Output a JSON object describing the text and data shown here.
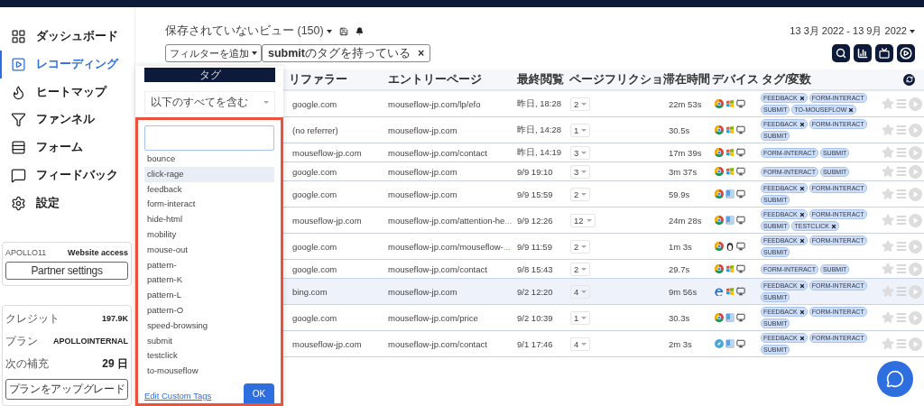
{
  "sidebar": {
    "items": [
      {
        "label": "ダッシュボード",
        "selected": false
      },
      {
        "label": "レコーディング",
        "selected": true
      },
      {
        "label": "ヒートマップ",
        "selected": false
      },
      {
        "label": "ファンネル",
        "selected": false
      },
      {
        "label": "フォーム",
        "selected": false
      },
      {
        "label": "フィードバック",
        "selected": false
      },
      {
        "label": "設定",
        "selected": false
      }
    ],
    "account_card": {
      "name": "APOLLO11",
      "access": "Website access",
      "button": "Partner settings"
    },
    "plan_card": {
      "rows": [
        {
          "label": "クレジット",
          "value": "197.9K"
        },
        {
          "label": "プラン",
          "value": "APOLLOINTERNAL"
        },
        {
          "label": "次の補充",
          "value": "29 日"
        }
      ],
      "button": "プランをアップグレード"
    }
  },
  "toolbar": {
    "view": "保存されていないビュー (150)",
    "date_range": "13 3月 2022 - 13 9月 2022",
    "add_filter": "フィルターを追加",
    "filter_chip": {
      "label": "**submit**のタグを持っている",
      "close": "×"
    }
  },
  "tag_dropdown": {
    "title": "タグ",
    "mode": "以下のすべてを含む",
    "options": [
      {
        "label": "bounce",
        "highlighted": false
      },
      {
        "label": "click-rage",
        "highlighted": true
      },
      {
        "label": "feedback",
        "highlighted": false
      },
      {
        "label": "form-interact",
        "highlighted": false
      },
      {
        "label": "hide-html",
        "highlighted": false
      },
      {
        "label": "mobility",
        "highlighted": false
      },
      {
        "label": "mouse-out",
        "highlighted": false
      },
      {
        "label": "pattern-",
        "highlighted": false
      },
      {
        "label": "pattern-K",
        "highlighted": false
      },
      {
        "label": "pattern-L",
        "highlighted": false
      },
      {
        "label": "pattern-O",
        "highlighted": false
      },
      {
        "label": "speed-browsing",
        "highlighted": false
      },
      {
        "label": "submit",
        "highlighted": false
      },
      {
        "label": "testclick",
        "highlighted": false
      },
      {
        "label": "to-mouseflow",
        "highlighted": false
      }
    ],
    "edit_link": "Edit Custom Tags",
    "ok": "OK"
  },
  "table": {
    "columns": [
      "リファラー",
      "エントリーページ",
      "最終閲覧",
      "ページ",
      "フリクショ",
      "滞在時間",
      "デバイス",
      "タグ/変数"
    ],
    "rows": [
      {
        "referrer": "google.com",
        "entry": "mouseflow-jp.com/lp/efo",
        "last": "昨日, 18:28",
        "pages": "2",
        "duration": "22m 53s",
        "devices": [
          {
            "kind": "chrome"
          },
          {
            "kind": "windows"
          },
          {
            "kind": "desktop"
          }
        ],
        "highlighted": false,
        "tags": [
          {
            "label": "FEEDBACK",
            "removable": true
          },
          {
            "label": "FORM-INTERACT",
            "removable": false
          },
          {
            "label": "SUBMIT",
            "removable": false
          },
          {
            "label": "TO-MOUSEFLOW",
            "removable": true
          }
        ]
      },
      {
        "referrer": "(no referrer)",
        "entry": "mouseflow-jp.com",
        "last": "昨日, 14:28",
        "pages": "1",
        "duration": "30.5s",
        "devices": [
          {
            "kind": "chrome"
          },
          {
            "kind": "windows"
          },
          {
            "kind": "desktop"
          }
        ],
        "highlighted": false,
        "tags": [
          {
            "label": "FEEDBACK",
            "removable": true
          },
          {
            "label": "FORM-INTERACT",
            "removable": false
          },
          {
            "label": "SUBMIT",
            "removable": false
          }
        ]
      },
      {
        "referrer": "mouseflow-jp.com",
        "entry": "mouseflow-jp.com/contact",
        "last": "昨日, 14:19",
        "pages": "3",
        "duration": "17m 39s",
        "devices": [
          {
            "kind": "chrome"
          },
          {
            "kind": "windows"
          },
          {
            "kind": "desktop"
          }
        ],
        "highlighted": false,
        "tags": [
          {
            "label": "FORM-INTERACT",
            "removable": false
          },
          {
            "label": "SUBMIT",
            "removable": false
          }
        ]
      },
      {
        "referrer": "google.com",
        "entry": "mouseflow-jp.com",
        "last": "9/9 19:10",
        "pages": "3",
        "duration": "3m 37s",
        "devices": [
          {
            "kind": "chrome"
          },
          {
            "kind": "windows"
          },
          {
            "kind": "desktop"
          }
        ],
        "highlighted": false,
        "tags": [
          {
            "label": "FORM-INTERACT",
            "removable": false
          },
          {
            "label": "SUBMIT",
            "removable": false
          }
        ]
      },
      {
        "referrer": "google.com",
        "entry": "mouseflow-jp.com",
        "last": "9/9 15:59",
        "pages": "2",
        "duration": "59.9s",
        "devices": [
          {
            "kind": "chrome"
          },
          {
            "kind": "mac"
          },
          {
            "kind": "desktop"
          }
        ],
        "highlighted": false,
        "tags": [
          {
            "label": "FEEDBACK",
            "removable": true
          },
          {
            "label": "FORM-INTERACT",
            "removable": false
          },
          {
            "label": "SUBMIT",
            "removable": false
          }
        ]
      },
      {
        "referrer": "mouseflow-jp.com",
        "entry": "mouseflow-jp.com/attention-he",
        "entry_more": "...",
        "last": "9/9 12:26",
        "pages": "12",
        "duration": "24m 28s",
        "devices": [
          {
            "kind": "chrome"
          },
          {
            "kind": "mac"
          },
          {
            "kind": "desktop"
          }
        ],
        "highlighted": false,
        "tags": [
          {
            "label": "FEEDBACK",
            "removable": true
          },
          {
            "label": "FORM-INTERACT",
            "removable": false
          },
          {
            "label": "SUBMIT",
            "removable": false
          },
          {
            "label": "TESTCLICK",
            "removable": true
          }
        ]
      },
      {
        "referrer": "google.com",
        "entry": "mouseflow-jp.com/mouseflow-",
        "entry_more": "...",
        "last": "9/9 11:59",
        "pages": "2",
        "duration": "1m 3s",
        "devices": [
          {
            "kind": "chrome"
          },
          {
            "kind": "linux"
          },
          {
            "kind": "desktop"
          }
        ],
        "highlighted": false,
        "tags": [
          {
            "label": "FEEDBACK",
            "removable": true
          },
          {
            "label": "FORM-INTERACT",
            "removable": false
          },
          {
            "label": "SUBMIT",
            "removable": false
          }
        ]
      },
      {
        "referrer": "google.com",
        "entry": "mouseflow-jp.com/contact",
        "last": "9/8 15:43",
        "pages": "2",
        "duration": "29.7s",
        "devices": [
          {
            "kind": "chrome"
          },
          {
            "kind": "windows"
          },
          {
            "kind": "desktop"
          }
        ],
        "highlighted": false,
        "tags": [
          {
            "label": "FORM-INTERACT",
            "removable": false
          },
          {
            "label": "SUBMIT",
            "removable": false
          }
        ]
      },
      {
        "referrer": "bing.com",
        "entry": "mouseflow-jp.com",
        "last": "9/2 12:20",
        "pages": "4",
        "duration": "9m 56s",
        "devices": [
          {
            "kind": "edge"
          },
          {
            "kind": "windows"
          },
          {
            "kind": "desktop"
          }
        ],
        "highlighted": true,
        "tags": [
          {
            "label": "FEEDBACK",
            "removable": true
          },
          {
            "label": "FORM-INTERACT",
            "removable": false
          },
          {
            "label": "SUBMIT",
            "removable": false
          }
        ]
      },
      {
        "referrer": "google.com",
        "entry": "mouseflow-jp.com/price",
        "last": "9/2 10:39",
        "pages": "1",
        "duration": "30.3s",
        "devices": [
          {
            "kind": "chrome"
          },
          {
            "kind": "mac"
          },
          {
            "kind": "desktop"
          }
        ],
        "highlighted": false,
        "tags": [
          {
            "label": "FEEDBACK",
            "removable": true
          },
          {
            "label": "FORM-INTERACT",
            "removable": false
          },
          {
            "label": "SUBMIT",
            "removable": false
          }
        ]
      },
      {
        "referrer": "mouseflow-jp.com",
        "entry": "mouseflow-jp.com/contact",
        "last": "9/1 17:46",
        "pages": "4",
        "duration": "2m 3s",
        "devices": [
          {
            "kind": "safari"
          },
          {
            "kind": "mac"
          },
          {
            "kind": "desktop"
          }
        ],
        "highlighted": false,
        "tags": [
          {
            "label": "FEEDBACK",
            "removable": true
          },
          {
            "label": "FORM-INTERACT",
            "removable": false
          },
          {
            "label": "SUBMIT",
            "removable": false
          }
        ]
      }
    ]
  }
}
